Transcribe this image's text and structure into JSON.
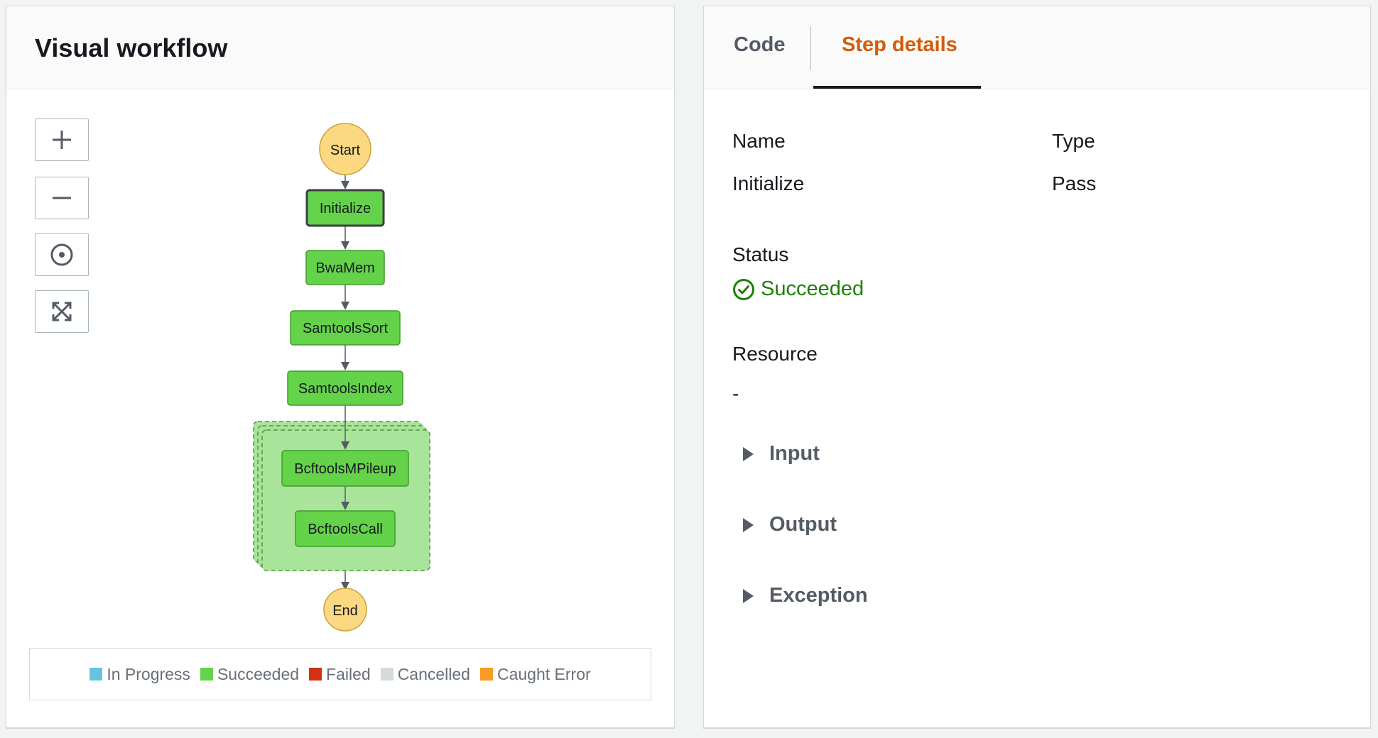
{
  "left_panel": {
    "title": "Visual workflow",
    "controls": [
      {
        "name": "zoom-in-button",
        "icon": "plus-icon"
      },
      {
        "name": "zoom-out-button",
        "icon": "minus-icon"
      },
      {
        "name": "center-button",
        "icon": "center-target-icon"
      },
      {
        "name": "fit-button",
        "icon": "expand-arrows-icon"
      }
    ],
    "graph": {
      "start_label": "Start",
      "end_label": "End",
      "nodes": [
        "Initialize",
        "BwaMem",
        "SamtoolsSort",
        "SamtoolsIndex",
        "BcftoolsMPileup",
        "BcftoolsCall"
      ],
      "selected_node": "Initialize",
      "colors": {
        "terminal": "#fbd881",
        "succeeded": "#65d34a",
        "parallel_bg": "#a8e59a",
        "edge": "#545b64"
      }
    },
    "legend": [
      {
        "label": "In Progress",
        "color": "#69c2e0"
      },
      {
        "label": "Succeeded",
        "color": "#65d34a"
      },
      {
        "label": "Failed",
        "color": "#d13212"
      },
      {
        "label": "Cancelled",
        "color": "#d5dbdb"
      },
      {
        "label": "Caught Error",
        "color": "#f89c24"
      }
    ]
  },
  "right_panel": {
    "tabs": {
      "code": "Code",
      "step_details": "Step details",
      "active": "step_details"
    },
    "name_label": "Name",
    "name_value": "Initialize",
    "type_label": "Type",
    "type_value": "Pass",
    "status_label": "Status",
    "status_value": "Succeeded",
    "resource_label": "Resource",
    "resource_value": "-",
    "sections": [
      "Input",
      "Output",
      "Exception"
    ],
    "colors": {
      "accent": "#d45b07",
      "success": "#1d8102"
    }
  }
}
